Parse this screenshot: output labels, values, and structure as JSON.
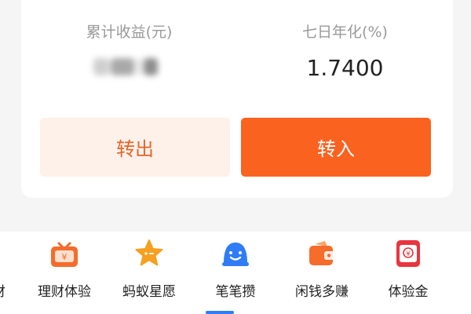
{
  "summary": {
    "cumulative_label": "累计收益(元)",
    "yield_label": "七日年化(%)",
    "yield_value": "1.7400"
  },
  "actions": {
    "transfer_out": "转出",
    "transfer_in": "转入"
  },
  "colors": {
    "accent": "#fa6220",
    "accent_light": "#fdf1ea",
    "blue": "#2f7cf6"
  },
  "shortcuts": {
    "cut_label": "财",
    "items": [
      {
        "label": "理财体验",
        "icon": "gift-box-icon"
      },
      {
        "label": "蚂蚁星愿",
        "icon": "star-icon"
      },
      {
        "label": "笔笔攒",
        "icon": "smile-piggy-icon"
      },
      {
        "label": "闲钱多赚",
        "icon": "wallet-icon"
      },
      {
        "label": "体验金",
        "icon": "red-envelope-icon"
      }
    ]
  }
}
